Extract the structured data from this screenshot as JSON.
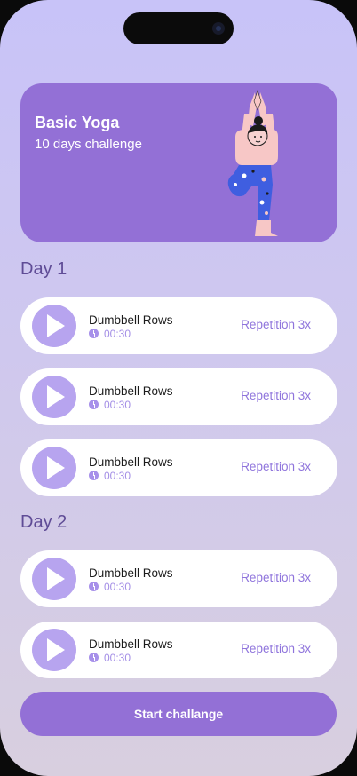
{
  "hero": {
    "title": "Basic Yoga",
    "subtitle": "10 days challenge",
    "illustration_icon": "yoga-tree-pose-woman"
  },
  "days": [
    {
      "label": "Day 1",
      "exercises": [
        {
          "name": "Dumbbell Rows",
          "duration": "00:30",
          "reps": "Repetition 3x"
        },
        {
          "name": "Dumbbell Rows",
          "duration": "00:30",
          "reps": "Repetition 3x"
        },
        {
          "name": "Dumbbell Rows",
          "duration": "00:30",
          "reps": "Repetition 3x"
        }
      ]
    },
    {
      "label": "Day 2",
      "exercises": [
        {
          "name": "Dumbbell Rows",
          "duration": "00:30",
          "reps": "Repetition 3x"
        },
        {
          "name": "Dumbbell Rows",
          "duration": "00:30",
          "reps": "Repetition 3x"
        }
      ]
    }
  ],
  "start_button": {
    "label": "Start challange"
  },
  "colors": {
    "accent": "#9370d6",
    "play_button": "#b7a4ef",
    "day_heading": "#5f4c96",
    "repetition_text": "#8f74dc"
  }
}
